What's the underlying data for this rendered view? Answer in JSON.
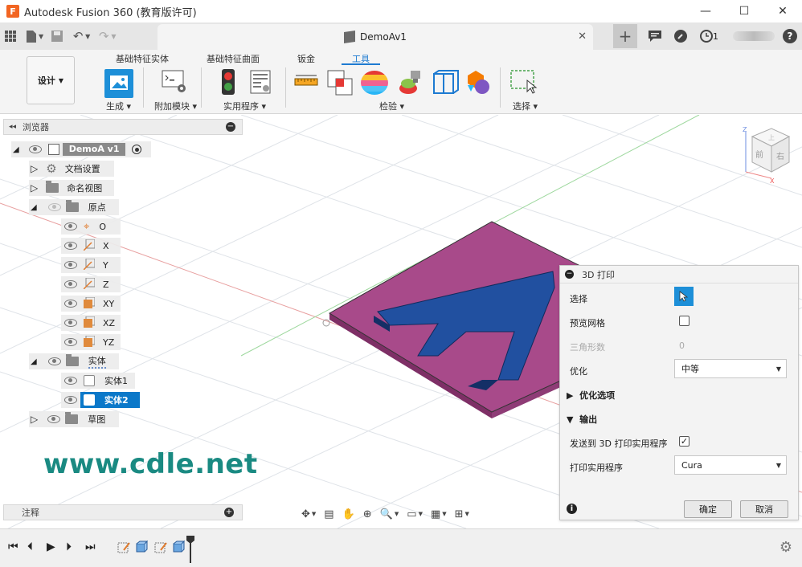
{
  "window": {
    "app_title": "Autodesk Fusion 360 (教育版许可)",
    "logo_letter": "F",
    "minimize": "—",
    "maximize": "☐",
    "close": "✕"
  },
  "tabbar": {
    "doc_name": "DemoAv1",
    "doc_close": "✕",
    "plus": "+",
    "job_count": "1",
    "help": "?"
  },
  "ribbon": {
    "workspace": "设计",
    "tabs": [
      "基础特征实体",
      "基础特征曲面",
      "钣金",
      "工具"
    ],
    "active_tab": "工具",
    "groups": {
      "make": "生成",
      "addins": "附加模块",
      "utilities": "实用程序",
      "inspect": "检验",
      "select": "选择"
    }
  },
  "browser": {
    "title": "浏览器",
    "root": "DemoA v1",
    "items": [
      {
        "label": "文档设置"
      },
      {
        "label": "命名视图"
      },
      {
        "label": "原点"
      },
      {
        "label": "O"
      },
      {
        "label": "X"
      },
      {
        "label": "Y"
      },
      {
        "label": "Z"
      },
      {
        "label": "XY"
      },
      {
        "label": "XZ"
      },
      {
        "label": "YZ"
      },
      {
        "label": "实体"
      },
      {
        "label": "实体1"
      },
      {
        "label": "实体2"
      },
      {
        "label": "草图"
      }
    ],
    "notes": "注释"
  },
  "watermark": "www.cdle.net",
  "viewcube": {
    "front": "前",
    "right": "右",
    "top": "上",
    "x": "X",
    "z": "Z"
  },
  "print_panel": {
    "title": "3D 打印",
    "select_label": "选择",
    "preview_mesh_label": "预览网格",
    "triangle_count_label": "三角形数",
    "triangle_count_value": "0",
    "refine_label": "优化",
    "refine_value": "中等",
    "refine_options_label": "优化选项",
    "output_label": "输出",
    "send_to_label": "发送到 3D 打印实用程序",
    "utility_label": "打印实用程序",
    "utility_value": "Cura",
    "ok": "确定",
    "cancel": "取消",
    "info": "i"
  },
  "colors": {
    "accent": "#1d7ad1",
    "plate": "#a84a8a",
    "letter": "#2150a0",
    "selected_row": "#0b78c9",
    "watermark": "#1a8a82"
  }
}
